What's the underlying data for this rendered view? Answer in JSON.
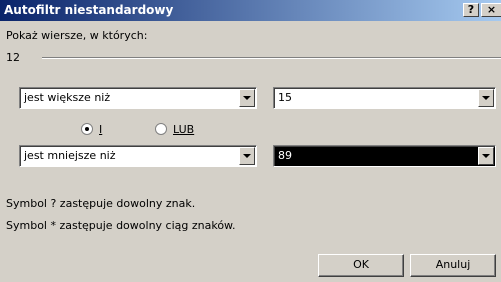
{
  "window": {
    "title": "Autofiltr niestandardowy",
    "help_label": "?",
    "close_label": "×"
  },
  "prompt": "Pokaż wiersze, w których:",
  "field_name": "12",
  "criteria": [
    {
      "operator": "jest większe niż",
      "value": "15"
    },
    {
      "operator": "jest mniejsze niż",
      "value": "89"
    }
  ],
  "logic": {
    "and_label": "I",
    "or_label": "LUB",
    "selected": "I"
  },
  "hints": [
    "Symbol ? zastępuje dowolny znak.",
    "Symbol * zastępuje dowolny ciąg znaków."
  ],
  "buttons": {
    "ok_label": "OK",
    "cancel_label": "Anuluj"
  }
}
